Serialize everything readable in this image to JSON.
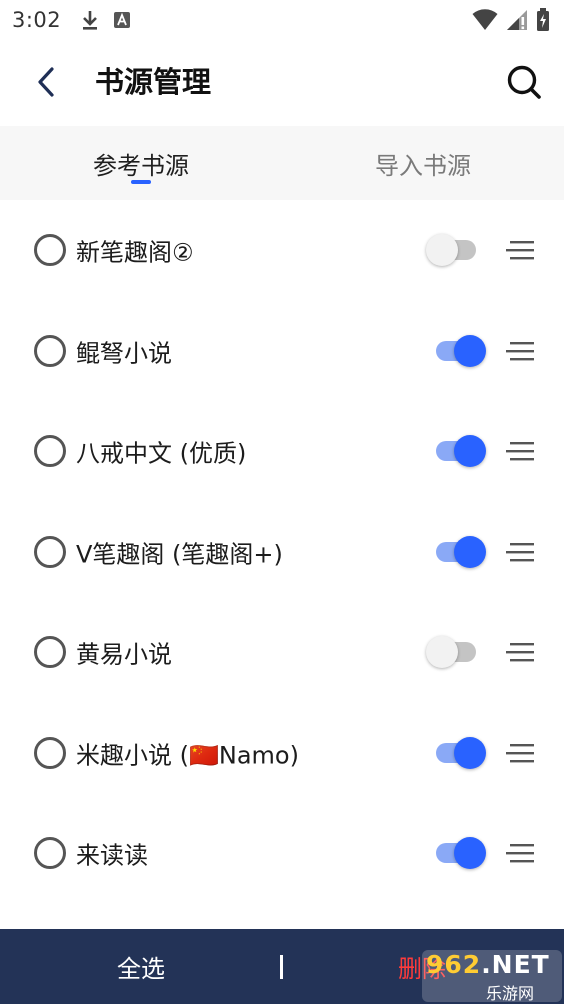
{
  "status_bar": {
    "time": "3:02",
    "icons": [
      "download-icon",
      "a-notification-icon",
      "wifi-icon",
      "signal-icon",
      "battery-icon"
    ]
  },
  "app_bar": {
    "title": "书源管理",
    "back_icon": "chevron-left-icon",
    "search_icon": "search-icon"
  },
  "tabs": [
    {
      "label": "参考书源",
      "active": true
    },
    {
      "label": "导入书源",
      "active": false
    }
  ],
  "sources": [
    {
      "name": "新笔趣阁②",
      "enabled": false,
      "selected": false
    },
    {
      "name": "鲲弩小说",
      "enabled": true,
      "selected": false
    },
    {
      "name": "八戒中文 (优质)",
      "enabled": true,
      "selected": false
    },
    {
      "name": "V笔趣阁 (笔趣阁+)",
      "enabled": true,
      "selected": false
    },
    {
      "name": "黄易小说",
      "enabled": false,
      "selected": false
    },
    {
      "name": "米趣小说 (🇨🇳Namo)",
      "enabled": true,
      "selected": false
    },
    {
      "name": "来读读",
      "enabled": true,
      "selected": false
    }
  ],
  "bottom_bar": {
    "select_all": "全选",
    "delete": "删除"
  },
  "watermark": {
    "num": "962",
    "suffix": ".NET",
    "sub": "乐游网"
  },
  "colors": {
    "accent": "#2962ff",
    "bottom_bar": "#233357",
    "delete": "#ff3b3b"
  }
}
